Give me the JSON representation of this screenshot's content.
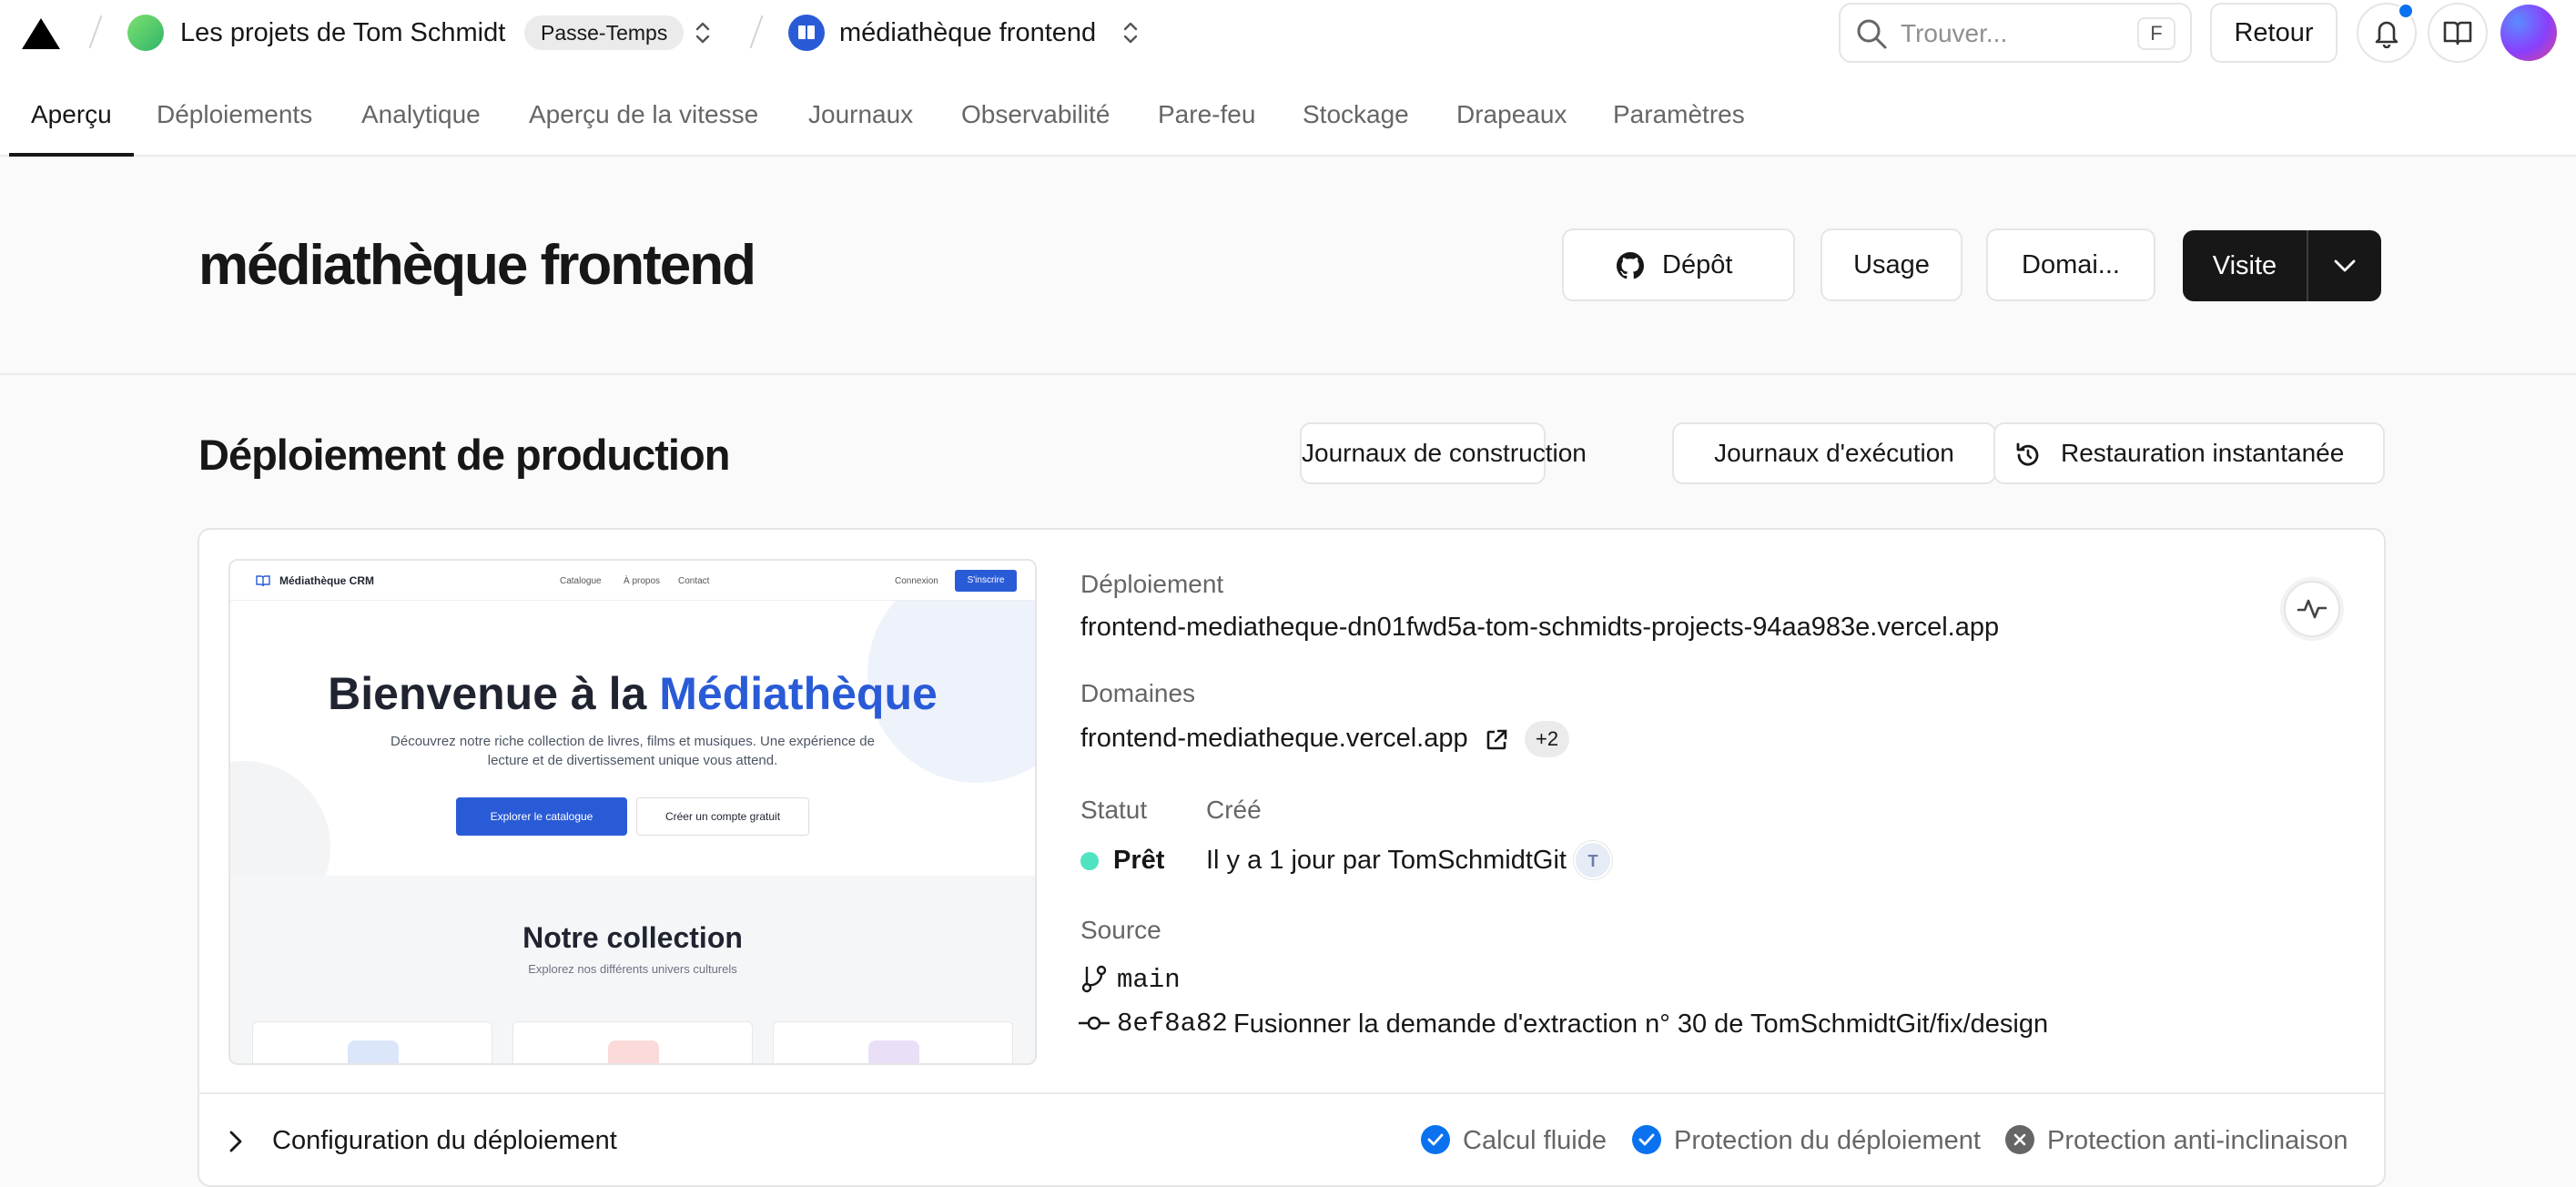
{
  "topbar": {
    "team_name": "Les projets de Tom Schmidt",
    "plan_badge": "Passe-Temps",
    "project_name": "médiathèque frontend",
    "search_placeholder": "Trouver...",
    "search_shortcut": "F",
    "back_label": "Retour"
  },
  "tabs": [
    {
      "label": "Aperçu",
      "active": true
    },
    {
      "label": "Déploiements"
    },
    {
      "label": "Analytique"
    },
    {
      "label": "Aperçu de la vitesse"
    },
    {
      "label": "Journaux"
    },
    {
      "label": "Observabilité"
    },
    {
      "label": "Pare-feu"
    },
    {
      "label": "Stockage"
    },
    {
      "label": "Drapeaux"
    },
    {
      "label": "Paramètres"
    }
  ],
  "header": {
    "title": "médiathèque frontend",
    "repo_label": "Dépôt",
    "usage_label": "Usage",
    "domains_label": "Domai...",
    "visit_label": "Visite"
  },
  "production": {
    "title": "Déploiement de production",
    "build_logs_label": "Journaux de construction",
    "runtime_logs_label": "Journaux d'exécution",
    "instant_rollback_label": "Restauration instantanée",
    "deployment_label": "Déploiement",
    "deployment_url": "frontend-mediatheque-dn01fwd5a-tom-schmidts-projects-94aa983e.vercel.app",
    "domains_label": "Domaines",
    "domain": "frontend-mediatheque.vercel.app",
    "domains_extra": "+2",
    "status_label": "Statut",
    "status_value": "Prêt",
    "created_label": "Créé",
    "created_value": "Il y a 1 jour par TomSchmidtGit",
    "created_avatar_initial": "T",
    "source_label": "Source",
    "branch": "main",
    "commit_hash": "8ef8a82",
    "commit_message": "Fusionner la demande d'extraction n° 30 de TomSchmidtGit/fix/design",
    "config_label": "Configuration du déploiement",
    "features": [
      {
        "label": "Calcul fluide",
        "enabled": true
      },
      {
        "label": "Protection du déploiement",
        "enabled": true
      },
      {
        "label": "Protection anti-inclinaison",
        "enabled": false
      }
    ]
  },
  "preview": {
    "brand": "Médiathèque CRM",
    "nav_links": [
      "Catalogue",
      "À propos",
      "Contact"
    ],
    "login": "Connexion",
    "signup": "S'inscrire",
    "hero_title_prefix": "Bienvenue à la",
    "hero_title_accent": "Médiathèque",
    "hero_text": "Découvrez notre riche collection de livres, films et musiques. Une expérience de lecture et de divertissement unique vous attend.",
    "cta_primary": "Explorer le catalogue",
    "cta_secondary": "Créer un compte gratuit",
    "collection_title": "Notre collection",
    "collection_subtitle": "Explorez nos différents univers culturels"
  },
  "colors": {
    "ready": "#50e3c2",
    "accent_blue": "#0a72ef",
    "preview_blue": "#2a5bd7"
  }
}
